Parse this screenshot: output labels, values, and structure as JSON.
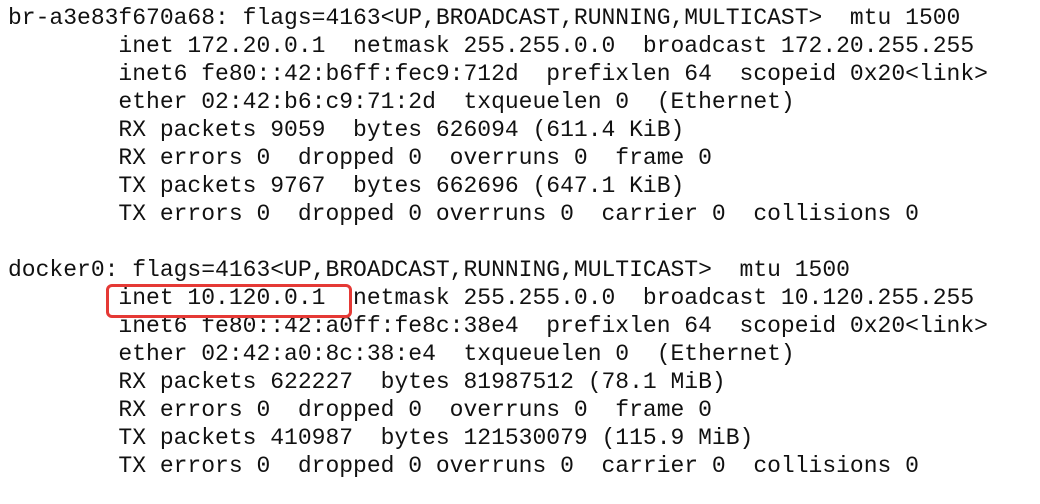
{
  "terminal": {
    "lines": [
      "br-a3e83f670a68: flags=4163<UP,BROADCAST,RUNNING,MULTICAST>  mtu 1500",
      "        inet 172.20.0.1  netmask 255.255.0.0  broadcast 172.20.255.255",
      "        inet6 fe80::42:b6ff:fec9:712d  prefixlen 64  scopeid 0x20<link>",
      "        ether 02:42:b6:c9:71:2d  txqueuelen 0  (Ethernet)",
      "        RX packets 9059  bytes 626094 (611.4 KiB)",
      "        RX errors 0  dropped 0  overruns 0  frame 0",
      "        TX packets 9767  bytes 662696 (647.1 KiB)",
      "        TX errors 0  dropped 0 overruns 0  carrier 0  collisions 0",
      "",
      "docker0: flags=4163<UP,BROADCAST,RUNNING,MULTICAST>  mtu 1500",
      "        inet 10.120.0.1  netmask 255.255.0.0  broadcast 10.120.255.255",
      "        inet6 fe80::42:a0ff:fe8c:38e4  prefixlen 64  scopeid 0x20<link>",
      "        ether 02:42:a0:8c:38:e4  txqueuelen 0  (Ethernet)",
      "        RX packets 622227  bytes 81987512 (78.1 MiB)",
      "        RX errors 0  dropped 0  overruns 0  frame 0",
      "        TX packets 410987  bytes 121530079 (115.9 MiB)",
      "        TX errors 0  dropped 0 overruns 0  carrier 0  collisions 0"
    ]
  },
  "colors": {
    "text": "#111111",
    "highlight": "#e53935",
    "background": "#ffffff"
  }
}
